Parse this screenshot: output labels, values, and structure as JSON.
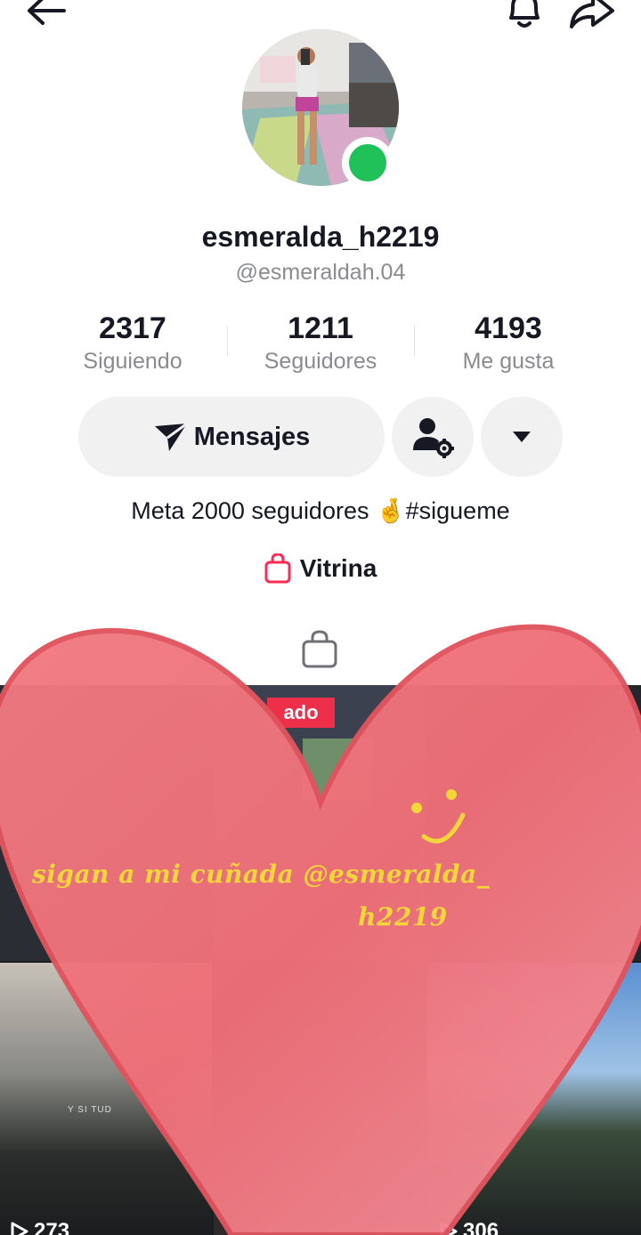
{
  "profile": {
    "display_name": "esmeralda_h2219",
    "handle": "@esmeraldah.04",
    "bio_text": "Meta 2000 seguidores",
    "bio_emoji": "🤞",
    "bio_hashtag": "#sigueme",
    "online": true
  },
  "stats": [
    {
      "value": "2317",
      "label": "Siguiendo"
    },
    {
      "value": "1211",
      "label": "Seguidores"
    },
    {
      "value": "4193",
      "label": "Me gusta"
    }
  ],
  "actions": {
    "message_label": "Mensajes"
  },
  "vitrina": {
    "label": "Vitrina"
  },
  "videos": [
    {
      "views": "273"
    },
    {
      "views": "306"
    }
  ],
  "thumbnail_tag": "ado",
  "thumbnail_caption": "Y SI TUD",
  "overlay": {
    "line1": "sigan a mi cuñada @esmeralda_",
    "line2": "h2219"
  },
  "colors": {
    "online": "#21c15a",
    "vitrina_bag": "#fe2c55",
    "heart": "#ef7078",
    "overlay_text": "#f4d63a"
  },
  "icons": [
    "back-arrow-icon",
    "bell-icon",
    "share-icon",
    "send-icon",
    "user-settings-icon",
    "caret-down-icon",
    "shopping-bag-icon",
    "play-icon",
    "smiley-icon",
    "heart-sticker"
  ]
}
